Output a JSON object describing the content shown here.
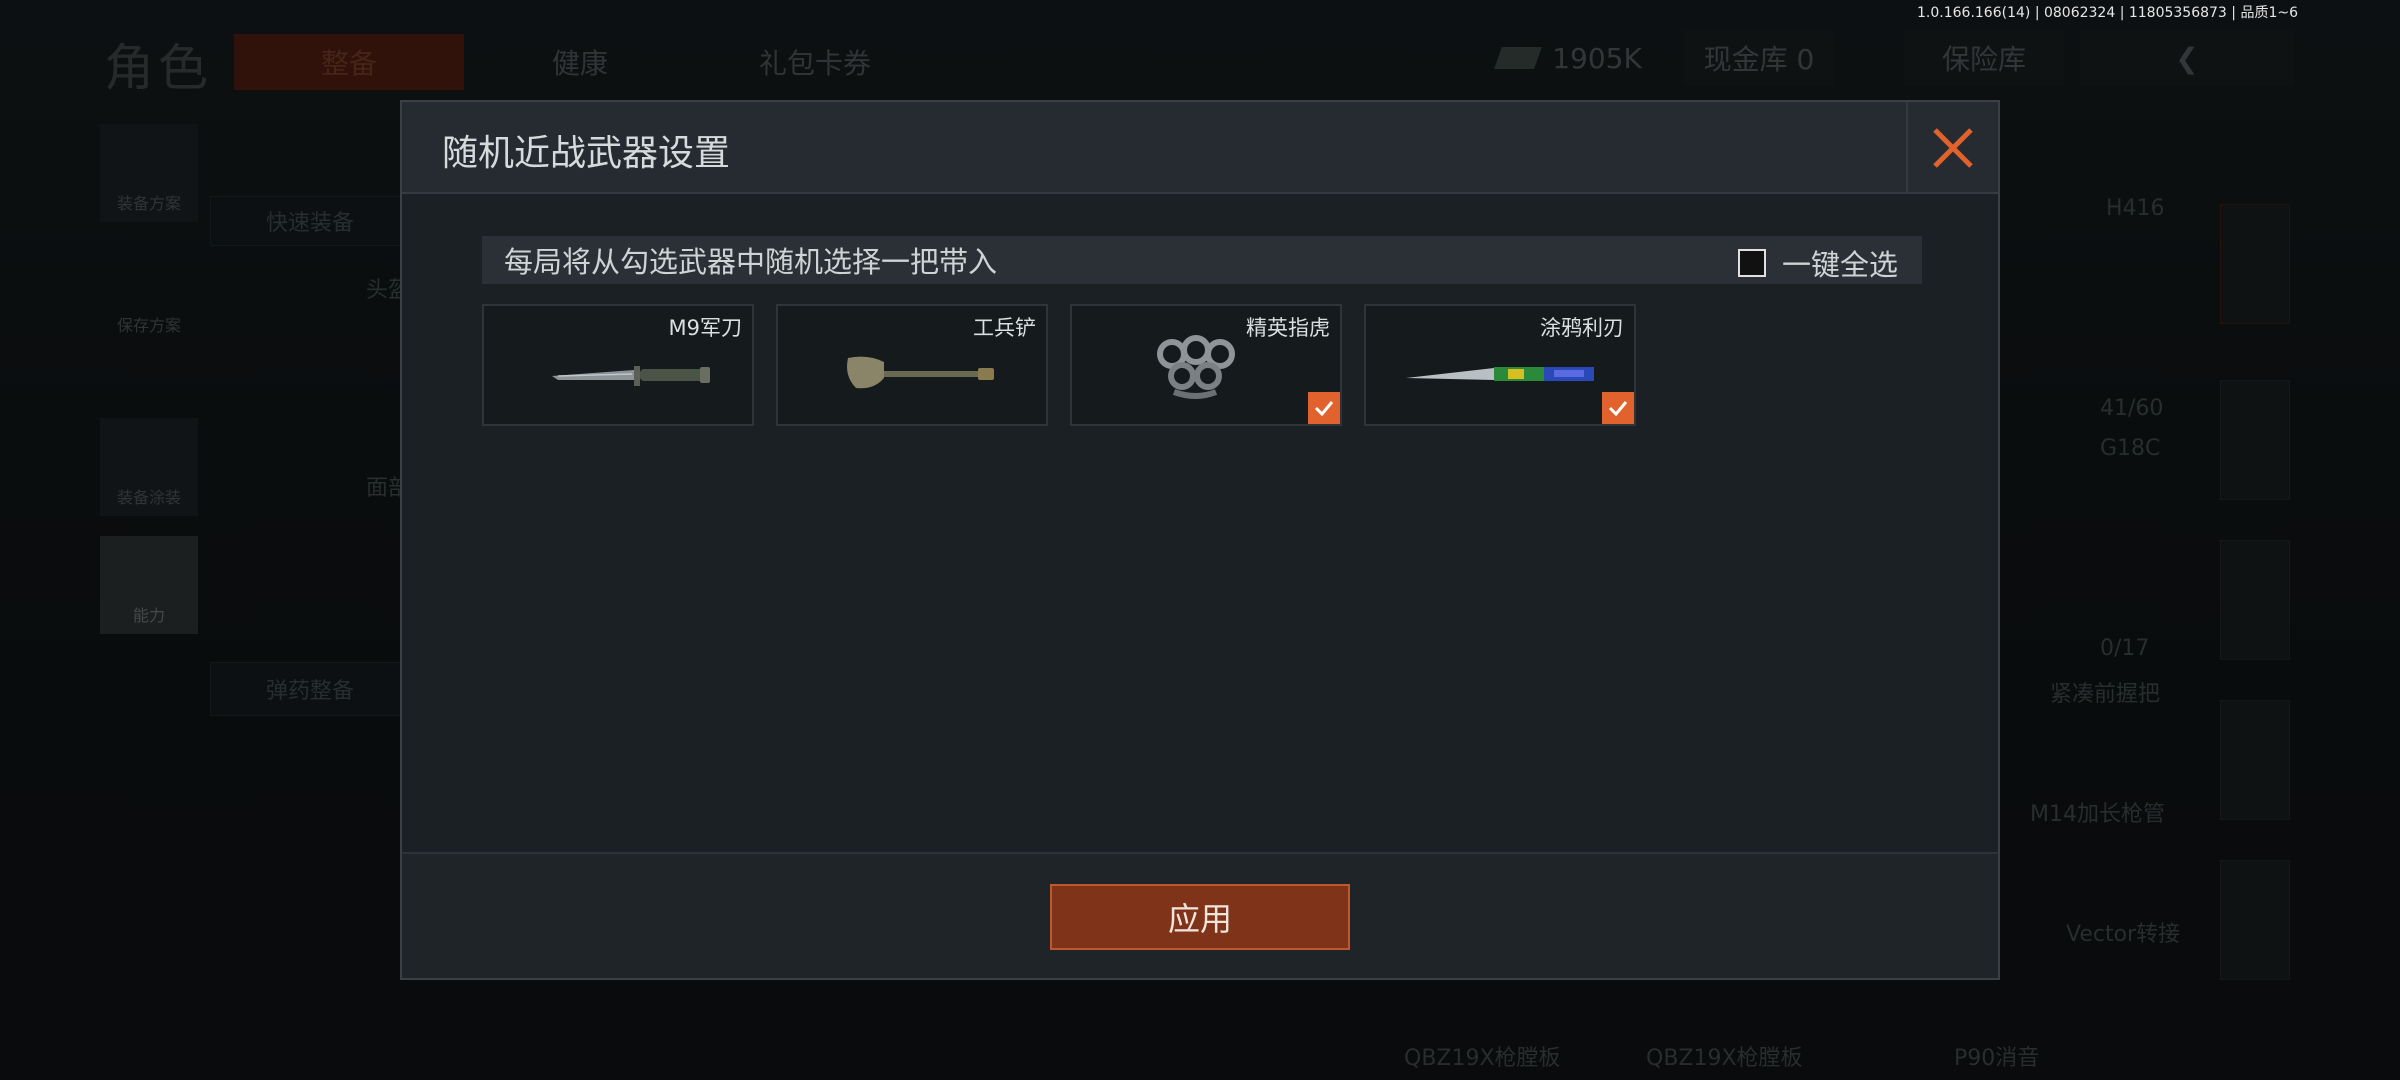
{
  "version": "1.0.166.166(14) | 08062324 | 11805356873 | 品质1~6",
  "background": {
    "title": "角色",
    "tabs": [
      "整备",
      "健康",
      "礼包卡券"
    ],
    "currency": "1905K",
    "cash_vault": "现金库 0",
    "safe": "保险库",
    "side_buttons": [
      "装备方案",
      "保存方案",
      "装备涂装",
      "能力"
    ],
    "quick_equip": "快速装备",
    "ammo_equip": "弹药整备",
    "slot_labels": [
      "头盔",
      "面部"
    ],
    "weapon_name": "H416",
    "ammo_count": "41/60",
    "attachment_labels": [
      "G18C",
      "紧凑前握把",
      "M14加长枪管",
      "Vector转接",
      "QBZ19X枪膛板",
      "QBZ19X枪膛板",
      "P90消音"
    ],
    "ammo_small": "0/17"
  },
  "dialog": {
    "title": "随机近战武器设置",
    "instruction": "每局将从勾选武器中随机选择一把带入",
    "select_all_label": "一键全选",
    "weapons": [
      {
        "name": "M9军刀",
        "icon": "bayonet-icon",
        "checked": false
      },
      {
        "name": "工兵铲",
        "icon": "shovel-icon",
        "checked": false
      },
      {
        "name": "精英指虎",
        "icon": "knuckles-icon",
        "checked": true
      },
      {
        "name": "涂鸦利刃",
        "icon": "butterfly-knife-icon",
        "checked": true
      }
    ],
    "apply_label": "应用"
  },
  "colors": {
    "accent": "#e1622c",
    "apply_bg": "#7f3318"
  }
}
